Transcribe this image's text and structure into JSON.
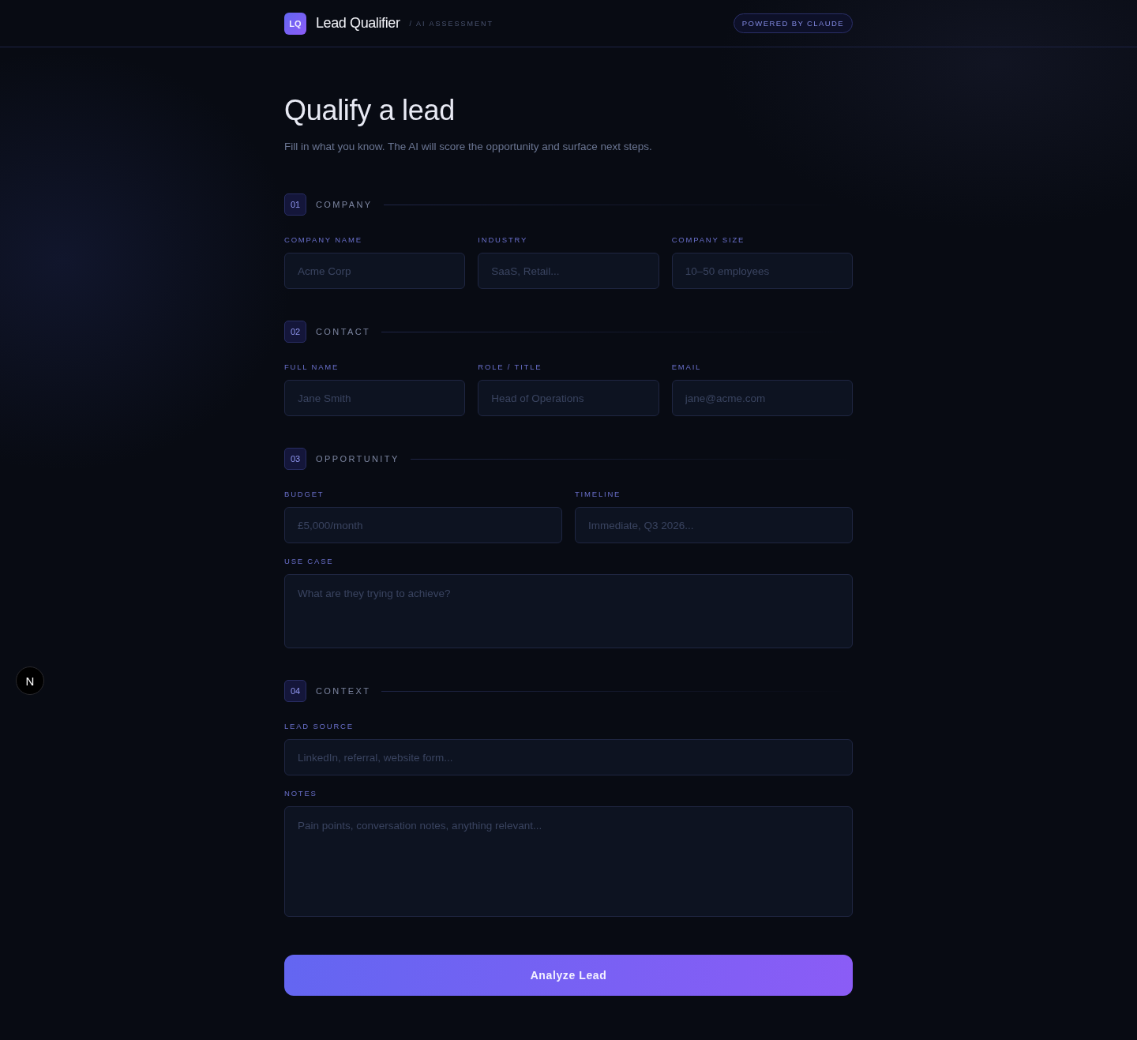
{
  "header": {
    "logo": "LQ",
    "title": "Lead Qualifier",
    "subtitle": "/ AI ASSESSMENT",
    "badge": "POWERED BY CLAUDE"
  },
  "intro": {
    "heading": "Qualify a lead",
    "description": "Fill in what you know. The AI will score the opportunity and surface next steps."
  },
  "sections": [
    {
      "number": "01",
      "title": "COMPANY",
      "rows": [
        [
          {
            "kind": "input",
            "label": "COMPANY NAME",
            "placeholder": "Acme Corp"
          },
          {
            "kind": "input",
            "label": "INDUSTRY",
            "placeholder": "SaaS, Retail..."
          },
          {
            "kind": "input",
            "label": "COMPANY SIZE",
            "placeholder": "10–50 employees"
          }
        ]
      ]
    },
    {
      "number": "02",
      "title": "CONTACT",
      "rows": [
        [
          {
            "kind": "input",
            "label": "FULL NAME",
            "placeholder": "Jane Smith"
          },
          {
            "kind": "input",
            "label": "ROLE / TITLE",
            "placeholder": "Head of Operations"
          },
          {
            "kind": "input",
            "label": "EMAIL",
            "placeholder": "jane@acme.com"
          }
        ]
      ]
    },
    {
      "number": "03",
      "title": "OPPORTUNITY",
      "rows": [
        [
          {
            "kind": "input",
            "label": "BUDGET",
            "placeholder": "£5,000/month"
          },
          {
            "kind": "input",
            "label": "TIMELINE",
            "placeholder": "Immediate, Q3 2026..."
          }
        ],
        [
          {
            "kind": "textarea",
            "label": "USE CASE",
            "placeholder": "What are they trying to achieve?"
          }
        ]
      ]
    },
    {
      "number": "04",
      "title": "CONTEXT",
      "rows": [
        [
          {
            "kind": "input",
            "label": "LEAD SOURCE",
            "placeholder": "LinkedIn, referral, website form..."
          }
        ],
        [
          {
            "kind": "longtext",
            "label": "NOTES",
            "placeholder": "Pain points, conversation notes, anything relevant..."
          }
        ]
      ]
    }
  ],
  "submit_button": "Analyze Lead",
  "dev_indicator": "N"
}
